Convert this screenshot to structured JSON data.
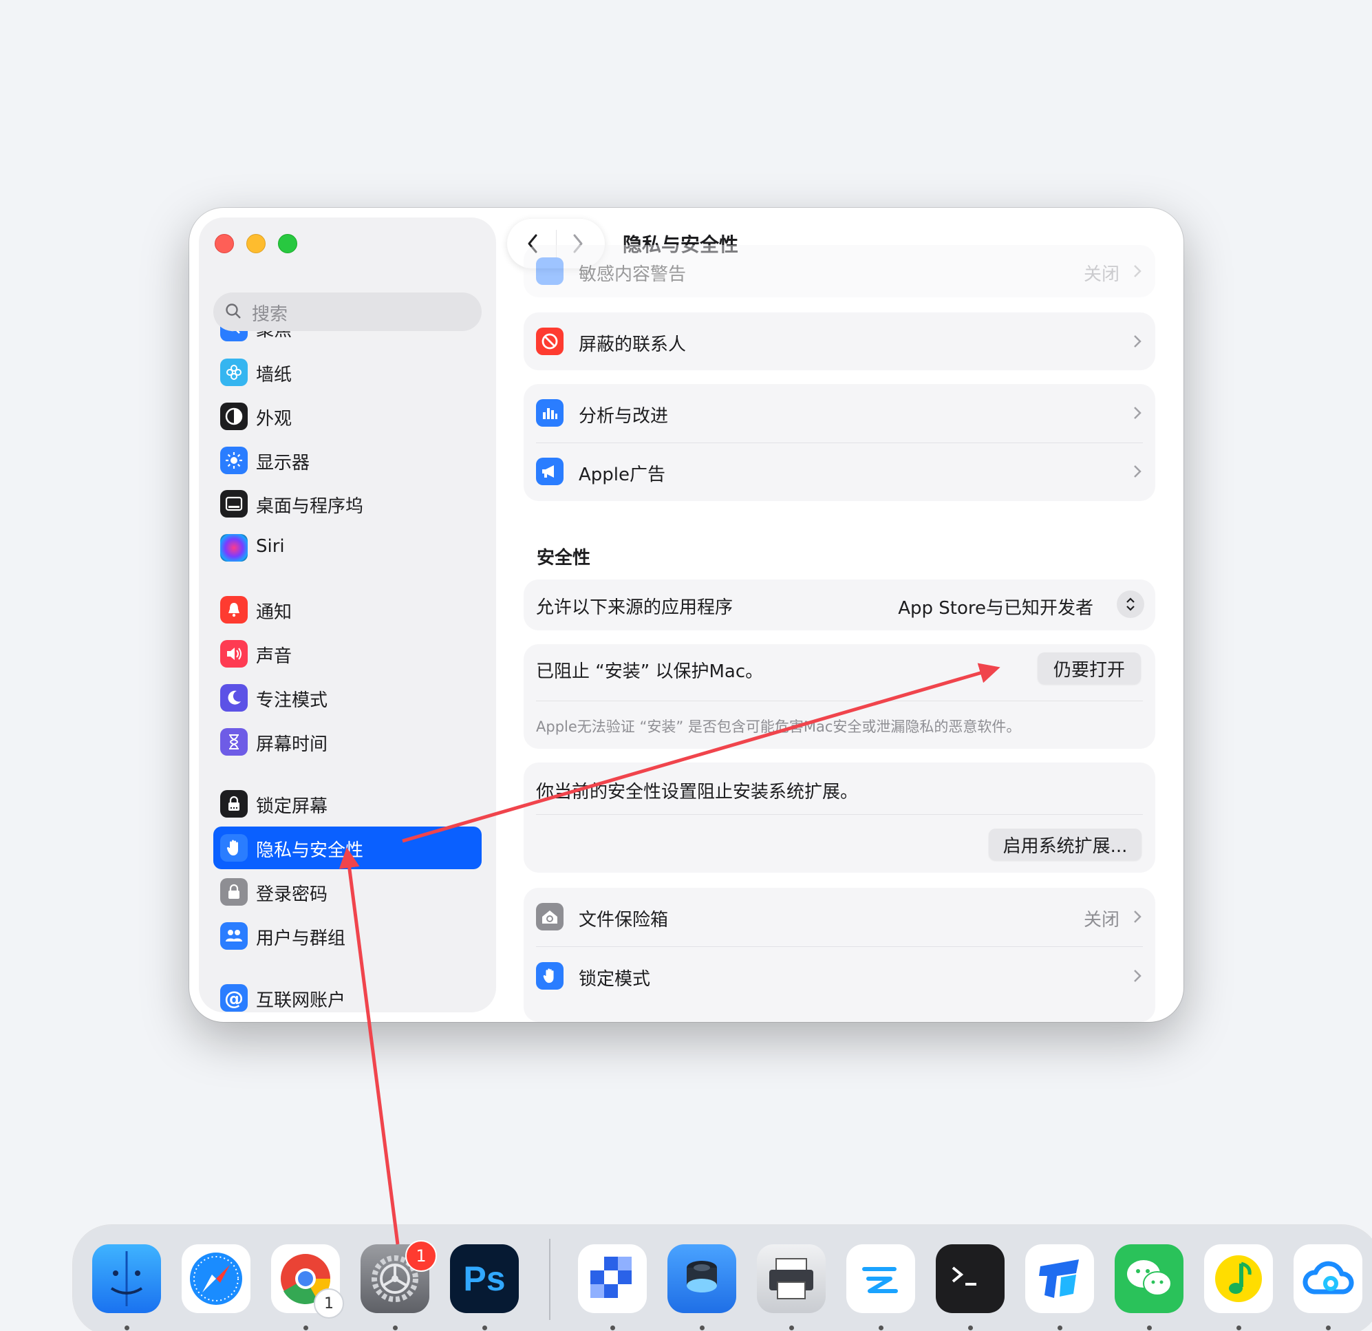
{
  "window": {
    "title": "隐私与安全性"
  },
  "sidebar": {
    "search_placeholder": "搜索",
    "items": [
      {
        "label": "聚焦",
        "icon": "spotlight-icon",
        "color": "#2a7dff"
      },
      {
        "label": "墙纸",
        "icon": "wallpaper-icon",
        "color": "#35b5f0"
      },
      {
        "label": "外观",
        "icon": "appearance-icon",
        "color": "#1d1d1f"
      },
      {
        "label": "显示器",
        "icon": "display-icon",
        "color": "#2a7dff"
      },
      {
        "label": "桌面与程序坞",
        "icon": "dock-icon",
        "color": "#1d1d1f"
      },
      {
        "label": "Siri",
        "icon": "siri-icon",
        "color": "#333"
      },
      {
        "label": "通知",
        "icon": "notification-icon",
        "color": "#fe3b30"
      },
      {
        "label": "声音",
        "icon": "sound-icon",
        "color": "#fe3b52"
      },
      {
        "label": "专注模式",
        "icon": "moon-icon",
        "color": "#5c52e6"
      },
      {
        "label": "屏幕时间",
        "icon": "hourglass-icon",
        "color": "#6e5ce6"
      },
      {
        "label": "锁定屏幕",
        "icon": "lock-screen-icon",
        "color": "#1d1d1f"
      },
      {
        "label": "隐私与安全性",
        "icon": "hand-icon",
        "color": "#2a7dff"
      },
      {
        "label": "登录密码",
        "icon": "lock-icon",
        "color": "#8e8e93"
      },
      {
        "label": "用户与群组",
        "icon": "users-icon",
        "color": "#2a7dff"
      },
      {
        "label": "互联网账户",
        "icon": "at-icon",
        "color": "#2a7dff"
      }
    ]
  },
  "content": {
    "partial_row": {
      "label": "敏感内容警告",
      "value": "关闭"
    },
    "blocked_contacts": {
      "label": "屏蔽的联系人"
    },
    "analytics": {
      "label": "分析与改进"
    },
    "apple_ads": {
      "label": "Apple广告"
    },
    "security_title": "安全性",
    "allow_apps": {
      "label": "允许以下来源的应用程序",
      "value": "App Store与已知开发者"
    },
    "blocked_app": {
      "label": "已阻止 “安装” 以保护Mac。",
      "button": "仍要打开",
      "note": "Apple无法验证 “安装” 是否包含可能危害Mac安全或泄漏隐私的恶意软件。"
    },
    "extension": {
      "label": "你当前的安全性设置阻止安装系统扩展。",
      "button": "启用系统扩展..."
    },
    "filevault": {
      "label": "文件保险箱",
      "value": "关闭"
    },
    "lockdown": {
      "label": "锁定模式"
    }
  },
  "dock": {
    "settings_badge": "1",
    "chrome_badge": "1",
    "apps": [
      "Finder",
      "Safari",
      "Chrome",
      "System Settings",
      "Photoshop",
      "App",
      "App",
      "Printer",
      "App",
      "Terminal",
      "App",
      "WeChat",
      "QQ Music",
      "Cloud"
    ],
    "photoshop_label": "Ps"
  },
  "colors": {
    "accent": "#0a60ff",
    "annotation_arrow": "#f0444c"
  }
}
